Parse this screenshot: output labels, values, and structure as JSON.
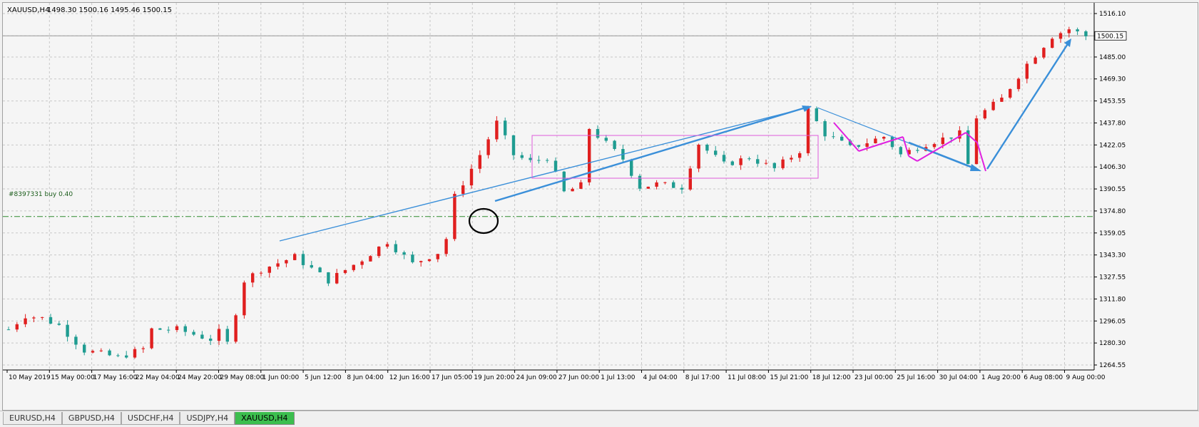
{
  "window": {
    "title": "XAUUSD,H4"
  },
  "chart": {
    "header": {
      "symbol": "XAUUSD,H4",
      "ohlc": "1498.30 1500.16 1495.46 1500.15"
    },
    "order_line": {
      "label": "#8397331 buy 0.40",
      "price": 1370.8
    },
    "current_price": "1500.15",
    "price_labels": [
      "1516.10",
      "1500.15",
      "1485.00",
      "1469.30",
      "1453.55",
      "1437.80",
      "1422.05",
      "1406.30",
      "1390.55",
      "1374.80",
      "1359.05",
      "1343.30",
      "1327.55",
      "1311.80",
      "1296.05",
      "1280.30",
      "1264.55"
    ],
    "time_labels": [
      "10 May 2019",
      "15 May 00:00",
      "17 May 16:00",
      "22 May 04:00",
      "24 May 20:00",
      "29 May 08:00",
      "1 Jun 00:00",
      "5 Jun 12:00",
      "8 Jun 04:00",
      "12 Jun 16:00",
      "17 Jun 05:00",
      "19 Jun 20:00",
      "24 Jun 09:00",
      "27 Jun 00:00",
      "1 Jul 13:00",
      "4 Jul 04:00",
      "8 Jul 17:00",
      "11 Jul 08:00",
      "15 Jul 21:00",
      "18 Jul 12:00",
      "23 Jul 00:00",
      "25 Jul 16:00",
      "30 Jul 04:00",
      "1 Aug 20:00",
      "6 Aug 08:00",
      "9 Aug 00:00"
    ],
    "colors": {
      "bull": "#e01f1f",
      "bear": "#1f9c91",
      "grid": "#c8c8c8",
      "order_line": "#2e8b2e",
      "trend_blue": "#3a8fd9",
      "range_magenta": "#e05cdc",
      "arrows_magenta": "#e020e0",
      "circle": "#000000"
    }
  },
  "chart_data": {
    "type": "candlestick",
    "symbol": "XAUUSD",
    "timeframe": "H4",
    "y_range": [
      1264.55,
      1516.1
    ],
    "price_path": [
      {
        "x": 0,
        "price": 1290
      },
      {
        "x": 2,
        "price": 1300
      },
      {
        "x": 4,
        "price": 1298
      },
      {
        "x": 6,
        "price": 1293
      },
      {
        "x": 9,
        "price": 1275
      },
      {
        "x": 13,
        "price": 1270
      },
      {
        "x": 16,
        "price": 1276
      },
      {
        "x": 17,
        "price": 1290
      },
      {
        "x": 20,
        "price": 1290
      },
      {
        "x": 24,
        "price": 1283
      },
      {
        "x": 25,
        "price": 1288
      },
      {
        "x": 26,
        "price": 1280
      },
      {
        "x": 28,
        "price": 1325
      },
      {
        "x": 30,
        "price": 1333
      },
      {
        "x": 34,
        "price": 1342
      },
      {
        "x": 38,
        "price": 1325
      },
      {
        "x": 42,
        "price": 1340
      },
      {
        "x": 45,
        "price": 1353
      },
      {
        "x": 48,
        "price": 1337
      },
      {
        "x": 51,
        "price": 1345
      },
      {
        "x": 52,
        "price": 1355
      },
      {
        "x": 53,
        "price": 1385
      },
      {
        "x": 56,
        "price": 1415
      },
      {
        "x": 58,
        "price": 1438
      },
      {
        "x": 60,
        "price": 1415
      },
      {
        "x": 62,
        "price": 1410
      },
      {
        "x": 64,
        "price": 1413
      },
      {
        "x": 66,
        "price": 1388
      },
      {
        "x": 68,
        "price": 1393
      },
      {
        "x": 69,
        "price": 1434
      },
      {
        "x": 73,
        "price": 1412
      },
      {
        "x": 75,
        "price": 1392
      },
      {
        "x": 77,
        "price": 1394
      },
      {
        "x": 80,
        "price": 1392
      },
      {
        "x": 82,
        "price": 1423
      },
      {
        "x": 85,
        "price": 1408
      },
      {
        "x": 88,
        "price": 1413
      },
      {
        "x": 91,
        "price": 1405
      },
      {
        "x": 94,
        "price": 1418
      },
      {
        "x": 95,
        "price": 1447
      },
      {
        "x": 97,
        "price": 1430
      },
      {
        "x": 100,
        "price": 1420
      },
      {
        "x": 104,
        "price": 1428
      },
      {
        "x": 106,
        "price": 1415
      },
      {
        "x": 109,
        "price": 1423
      },
      {
        "x": 113,
        "price": 1430
      },
      {
        "x": 114,
        "price": 1408
      },
      {
        "x": 115,
        "price": 1442
      },
      {
        "x": 118,
        "price": 1455
      },
      {
        "x": 121,
        "price": 1480
      },
      {
        "x": 124,
        "price": 1500
      },
      {
        "x": 126,
        "price": 1505
      },
      {
        "x": 128,
        "price": 1500
      }
    ]
  },
  "tabs": [
    {
      "label": "EURUSD,H4",
      "active": false
    },
    {
      "label": "GBPUSD,H4",
      "active": false
    },
    {
      "label": "USDCHF,H4",
      "active": false
    },
    {
      "label": "USDJPY,H4",
      "active": false
    },
    {
      "label": "XAUUSD,H4",
      "active": true
    }
  ]
}
